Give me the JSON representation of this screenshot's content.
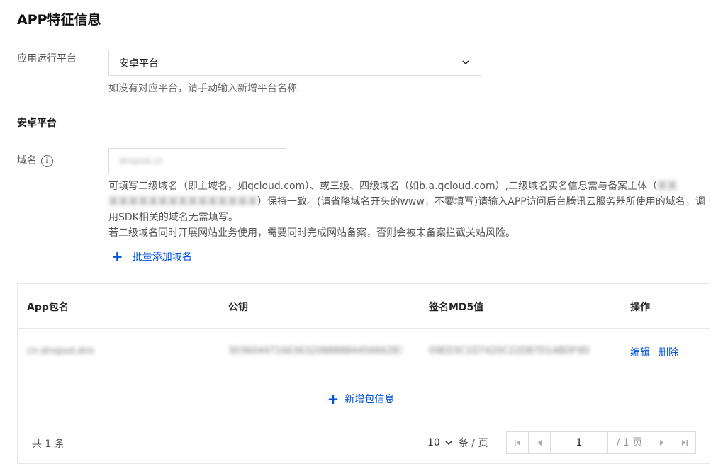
{
  "page": {
    "title": "APP特征信息"
  },
  "platform": {
    "label": "应用运行平台",
    "selected": "安卓平台",
    "hint": "如没有对应平台，请手动输入新增平台名称"
  },
  "section": {
    "title": "安卓平台"
  },
  "domain": {
    "label": "域名",
    "info_icon": "info-icon",
    "value": "dnspod.cn",
    "desc_line1": "可填写二级域名（即主域名，如qcloud.com）、或三级、四级域名（如b.a.qcloud.com）,二级域名实名信息需与备案主体（",
    "desc_blur1": "某某",
    "desc_blur2": "某某某某某某某某某某某某某某某",
    "desc_line2": "）保持一致。(请省略域名开头的www，不要填写)请输入APP访问后台腾讯云服务器所使用的域名，调",
    "desc_line3": "用SDK相关的域名无需填写。",
    "desc_line4": "若二级域名同时开展网站业务使用，需要同时完成网站备案，否则会被未备案拦截关站风险。",
    "batch_add": "批量添加域名"
  },
  "table": {
    "headers": [
      "App包名",
      "公钥",
      "签名MD5值",
      "操作"
    ],
    "rows": [
      {
        "package": "cn.dnspod.dns",
        "public_key": "3036044716636320888884456662833",
        "md5": "09ED3C1D7420C22D87D14BDF9D",
        "edit": "编辑",
        "delete": "删除"
      }
    ],
    "add_row": "新增包信息"
  },
  "pagination": {
    "total": "共 1 条",
    "page_size": "10",
    "page_size_unit": "条 / 页",
    "current": "1",
    "total_pages": "/ 1 页"
  },
  "colors": {
    "accent": "#0052d9",
    "border": "#dcdcdc"
  }
}
